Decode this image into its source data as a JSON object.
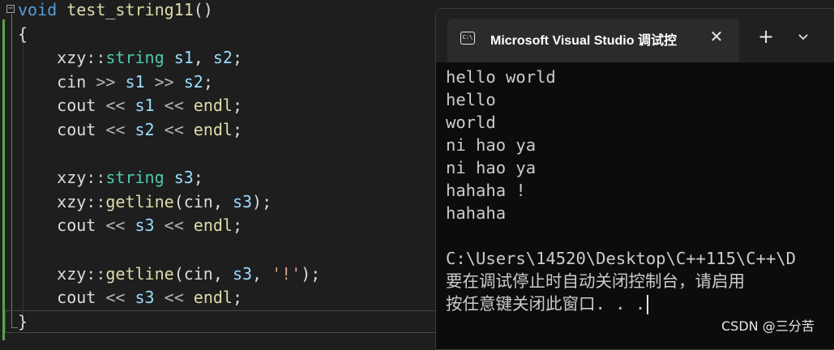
{
  "editor": {
    "lines": [
      {
        "segs": [
          {
            "c": "kw",
            "t": "void"
          },
          {
            "c": "pl",
            "t": " "
          },
          {
            "c": "fn",
            "t": "test_string11"
          },
          {
            "c": "pl",
            "t": "()"
          }
        ]
      },
      {
        "segs": [
          {
            "c": "pl",
            "t": "{"
          }
        ]
      },
      {
        "segs": [
          {
            "c": "pl",
            "t": "    xzy"
          },
          {
            "c": "ns",
            "t": "::"
          },
          {
            "c": "ty",
            "t": "string"
          },
          {
            "c": "pl",
            "t": " "
          },
          {
            "c": "var",
            "t": "s1"
          },
          {
            "c": "pl",
            "t": ", "
          },
          {
            "c": "var",
            "t": "s2"
          },
          {
            "c": "pl",
            "t": ";"
          }
        ]
      },
      {
        "segs": [
          {
            "c": "pl",
            "t": "    cin "
          },
          {
            "c": "op",
            "t": ">>"
          },
          {
            "c": "pl",
            "t": " "
          },
          {
            "c": "var",
            "t": "s1"
          },
          {
            "c": "pl",
            "t": " "
          },
          {
            "c": "op",
            "t": ">>"
          },
          {
            "c": "pl",
            "t": " "
          },
          {
            "c": "var",
            "t": "s2"
          },
          {
            "c": "pl",
            "t": ";"
          }
        ]
      },
      {
        "segs": [
          {
            "c": "pl",
            "t": "    cout "
          },
          {
            "c": "op",
            "t": "<<"
          },
          {
            "c": "pl",
            "t": " "
          },
          {
            "c": "var",
            "t": "s1"
          },
          {
            "c": "pl",
            "t": " "
          },
          {
            "c": "op",
            "t": "<<"
          },
          {
            "c": "pl",
            "t": " "
          },
          {
            "c": "fn",
            "t": "endl"
          },
          {
            "c": "pl",
            "t": ";"
          }
        ]
      },
      {
        "segs": [
          {
            "c": "pl",
            "t": "    cout "
          },
          {
            "c": "op",
            "t": "<<"
          },
          {
            "c": "pl",
            "t": " "
          },
          {
            "c": "var",
            "t": "s2"
          },
          {
            "c": "pl",
            "t": " "
          },
          {
            "c": "op",
            "t": "<<"
          },
          {
            "c": "pl",
            "t": " "
          },
          {
            "c": "fn",
            "t": "endl"
          },
          {
            "c": "pl",
            "t": ";"
          }
        ]
      },
      {
        "segs": []
      },
      {
        "segs": [
          {
            "c": "pl",
            "t": "    xzy"
          },
          {
            "c": "ns",
            "t": "::"
          },
          {
            "c": "ty",
            "t": "string"
          },
          {
            "c": "pl",
            "t": " "
          },
          {
            "c": "var",
            "t": "s3"
          },
          {
            "c": "pl",
            "t": ";"
          }
        ]
      },
      {
        "segs": [
          {
            "c": "pl",
            "t": "    xzy"
          },
          {
            "c": "ns",
            "t": "::"
          },
          {
            "c": "fn",
            "t": "getline"
          },
          {
            "c": "pl",
            "t": "(cin, "
          },
          {
            "c": "var",
            "t": "s3"
          },
          {
            "c": "pl",
            "t": ");"
          }
        ]
      },
      {
        "segs": [
          {
            "c": "pl",
            "t": "    cout "
          },
          {
            "c": "op",
            "t": "<<"
          },
          {
            "c": "pl",
            "t": " "
          },
          {
            "c": "var",
            "t": "s3"
          },
          {
            "c": "pl",
            "t": " "
          },
          {
            "c": "op",
            "t": "<<"
          },
          {
            "c": "pl",
            "t": " "
          },
          {
            "c": "fn",
            "t": "endl"
          },
          {
            "c": "pl",
            "t": ";"
          }
        ]
      },
      {
        "segs": []
      },
      {
        "segs": [
          {
            "c": "pl",
            "t": "    xzy"
          },
          {
            "c": "ns",
            "t": "::"
          },
          {
            "c": "fn",
            "t": "getline"
          },
          {
            "c": "pl",
            "t": "(cin, "
          },
          {
            "c": "var",
            "t": "s3"
          },
          {
            "c": "pl",
            "t": ", "
          },
          {
            "c": "str",
            "t": "'!'"
          },
          {
            "c": "pl",
            "t": ");"
          }
        ]
      },
      {
        "segs": [
          {
            "c": "pl",
            "t": "    cout "
          },
          {
            "c": "op",
            "t": "<<"
          },
          {
            "c": "pl",
            "t": " "
          },
          {
            "c": "var",
            "t": "s3"
          },
          {
            "c": "pl",
            "t": " "
          },
          {
            "c": "op",
            "t": "<<"
          },
          {
            "c": "pl",
            "t": " "
          },
          {
            "c": "fn",
            "t": "endl"
          },
          {
            "c": "pl",
            "t": ";"
          }
        ]
      },
      {
        "segs": [
          {
            "c": "pl",
            "t": "}"
          }
        ]
      }
    ],
    "fold_glyph": "−"
  },
  "console": {
    "icon_label": "C:\\",
    "title": "Microsoft Visual Studio 调试控",
    "close_glyph": "✕",
    "new_tab_glyph": "+",
    "output": [
      "hello world",
      "hello",
      "world",
      "ni hao ya",
      "ni hao ya",
      "hahaha !",
      "hahaha",
      "",
      "C:\\Users\\14520\\Desktop\\C++115\\C++\\D",
      "要在调试停止时自动关闭控制台，请启用",
      "按任意键关闭此窗口. . ."
    ]
  },
  "watermark": "CSDN @三分苦",
  "colors": {
    "editor_bg": "#1e1e1e",
    "console_bg": "#0c0c0c",
    "titlebar_bg": "#202020",
    "keyword": "#569cd6",
    "function": "#dcdcaa",
    "type": "#4ec9b0",
    "variable": "#9cdcfe",
    "string": "#d69d85",
    "change_bar": "#57a64a"
  }
}
